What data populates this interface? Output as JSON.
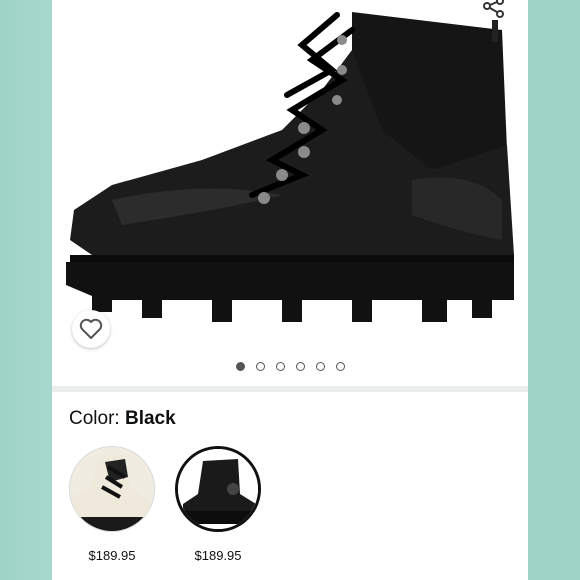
{
  "product": {
    "image_count": 6,
    "active_image_index": 0
  },
  "variation": {
    "label": "Color: ",
    "selected": "Black"
  },
  "swatches": [
    {
      "name": "cream",
      "price": "$189.95",
      "selected": false
    },
    {
      "name": "black",
      "price": "$189.95",
      "selected": true
    }
  ],
  "colors": {
    "side_bg": "#a8d8cd",
    "divider": "#eceeee",
    "text": "#0f1111"
  },
  "icons": {
    "share": "share-icon",
    "wishlist": "heart-icon"
  }
}
